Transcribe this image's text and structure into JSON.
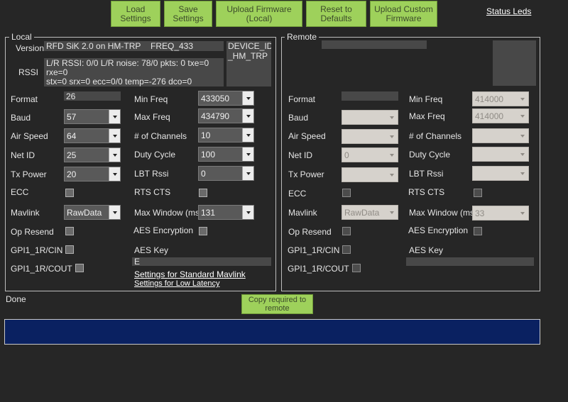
{
  "toolbar": {
    "load_settings": "Load\nSettings",
    "save_settings": "Save\nSettings",
    "upload_firmware_local": "Upload Firmware\n(Local)",
    "reset_to_defaults": "Reset to\nDefaults",
    "upload_custom_firmware": "Upload Custom\nFirmware",
    "status_leds": "Status Leds"
  },
  "local": {
    "legend": "Local",
    "version_label": "Version",
    "version_value": "RFD SiK 2.0 on HM-TRP",
    "freq_value": "FREQ_433",
    "device_id": "DEVICE_ID\n_HM_TRP",
    "rssi_label": "RSSI",
    "rssi_value": "L/R RSSI: 0/0  L/R noise: 78/0 pkts: 0  txe=0 rxe=0\nstx=0 srx=0 ecc=0/0 temp=-276 dco=0",
    "format_label": "Format",
    "format_value": "26",
    "baud_label": "Baud",
    "baud_value": "57",
    "air_speed_label": "Air Speed",
    "air_speed_value": "64",
    "net_id_label": "Net ID",
    "net_id_value": "25",
    "tx_power_label": "Tx Power",
    "tx_power_value": "20",
    "ecc_label": "ECC",
    "mavlink_label": "Mavlink",
    "mavlink_value": "RawData",
    "op_resend_label": "Op Resend",
    "gpi_cin_label": "GPI1_1R/CIN",
    "gpi_cout_label": "GPI1_1R/COUT",
    "min_freq_label": "Min Freq",
    "min_freq_value": "433050",
    "max_freq_label": "Max Freq",
    "max_freq_value": "434790",
    "channels_label": "# of Channels",
    "channels_value": "10",
    "duty_cycle_label": "Duty Cycle",
    "duty_cycle_value": "100",
    "lbt_rssi_label": "LBT Rssi",
    "lbt_rssi_value": "0",
    "rts_cts_label": "RTS CTS",
    "max_window_label": "Max Window (ms)",
    "max_window_value": "131",
    "aes_encryption_label": "AES Encryption",
    "aes_key_label": "AES Key",
    "aes_key_value": "E",
    "link_standard_mavlink": "Settings for Standard Mavlink",
    "link_low_latency": "Settings for Low Latency"
  },
  "remote": {
    "legend": "Remote",
    "format_label": "Format",
    "baud_label": "Baud",
    "air_speed_label": "Air Speed",
    "net_id_label": "Net ID",
    "net_id_value": "0",
    "tx_power_label": "Tx Power",
    "ecc_label": "ECC",
    "mavlink_label": "Mavlink",
    "mavlink_value": "RawData",
    "op_resend_label": "Op Resend",
    "gpi_cin_label": "GPI1_1R/CIN",
    "gpi_cout_label": "GPI1_1R/COUT",
    "min_freq_label": "Min Freq",
    "min_freq_value": "414000",
    "max_freq_label": "Max Freq",
    "max_freq_value": "414000",
    "channels_label": "# of Channels",
    "duty_cycle_label": "Duty Cycle",
    "lbt_rssi_label": "LBT Rssi",
    "rts_cts_label": "RTS CTS",
    "max_window_label": "Max Window (ms)",
    "max_window_value": "33",
    "aes_encryption_label": "AES Encryption",
    "aes_key_label": "AES Key"
  },
  "status": {
    "text": "Done",
    "copy_button": "Copy required to\nremote"
  }
}
